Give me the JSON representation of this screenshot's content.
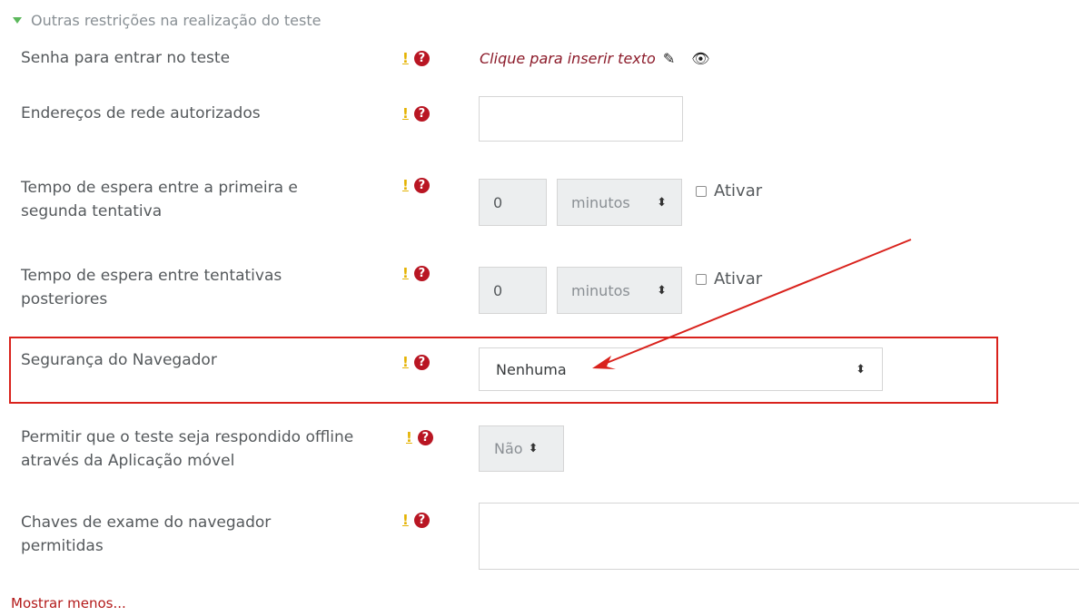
{
  "section": {
    "title": "Outras restrições na realização do teste",
    "show_less": "Mostrar menos..."
  },
  "icons": {
    "advanced_marker": "!",
    "help": "?"
  },
  "fields": {
    "password": {
      "label": "Senha para entrar no teste",
      "inplace_text": "Clique para inserir texto"
    },
    "subnet": {
      "label": "Endereços de rede autorizados",
      "value": ""
    },
    "delay1": {
      "label_line1": "Tempo de espera entre a primeira e",
      "label_line2": "segunda tentativa",
      "value": "0",
      "unit": "minutos",
      "enable": "Ativar"
    },
    "delay2": {
      "label_line1": "Tempo de espera entre tentativas",
      "label_line2": "posteriores",
      "value": "0",
      "unit": "minutos",
      "enable": "Ativar"
    },
    "browser_security": {
      "label": "Segurança do Navegador",
      "value": "Nenhuma"
    },
    "offline": {
      "label_line1": "Permitir que o teste seja respondido offline",
      "label_line2": "através da Aplicação móvel",
      "value": "Não"
    },
    "exam_keys": {
      "label_line1": "Chaves de exame do navegador",
      "label_line2": "permitidas",
      "value": ""
    }
  },
  "colors": {
    "help_icon": "#b91623",
    "advanced_marker": "#e4b200",
    "link": "#b31919",
    "annotation": "#d9221c",
    "section_caret": "#5cb85c"
  }
}
